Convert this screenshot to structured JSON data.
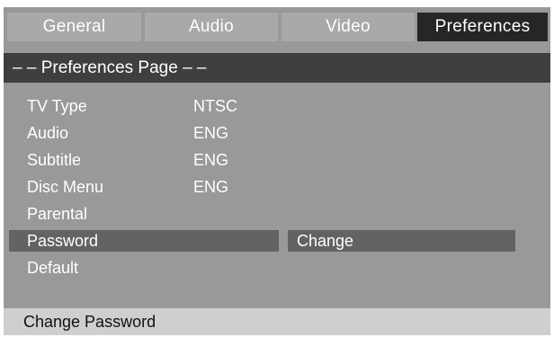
{
  "tabs": [
    {
      "label": "General",
      "active": false
    },
    {
      "label": "Audio",
      "active": false
    },
    {
      "label": "Video",
      "active": false
    },
    {
      "label": "Preferences",
      "active": true
    }
  ],
  "page_header": "– – Preferences Page – –",
  "menu": [
    {
      "label": "TV Type",
      "value": "NTSC"
    },
    {
      "label": "Audio",
      "value": "ENG"
    },
    {
      "label": "Subtitle",
      "value": "ENG"
    },
    {
      "label": "Disc Menu",
      "value": "ENG"
    },
    {
      "label": "Parental",
      "value": ""
    },
    {
      "label": "Password",
      "value": "",
      "selected": true
    },
    {
      "label": "Default",
      "value": ""
    }
  ],
  "submenu": {
    "option": "Change"
  },
  "status_text": "Change Password",
  "colors": {
    "panel": "#999999",
    "tab_inactive": "#a9a9a9",
    "tab_active": "#262626",
    "header_bar": "#3f3f3f",
    "selection": "#636363",
    "status_bar": "#cfcfcf"
  }
}
